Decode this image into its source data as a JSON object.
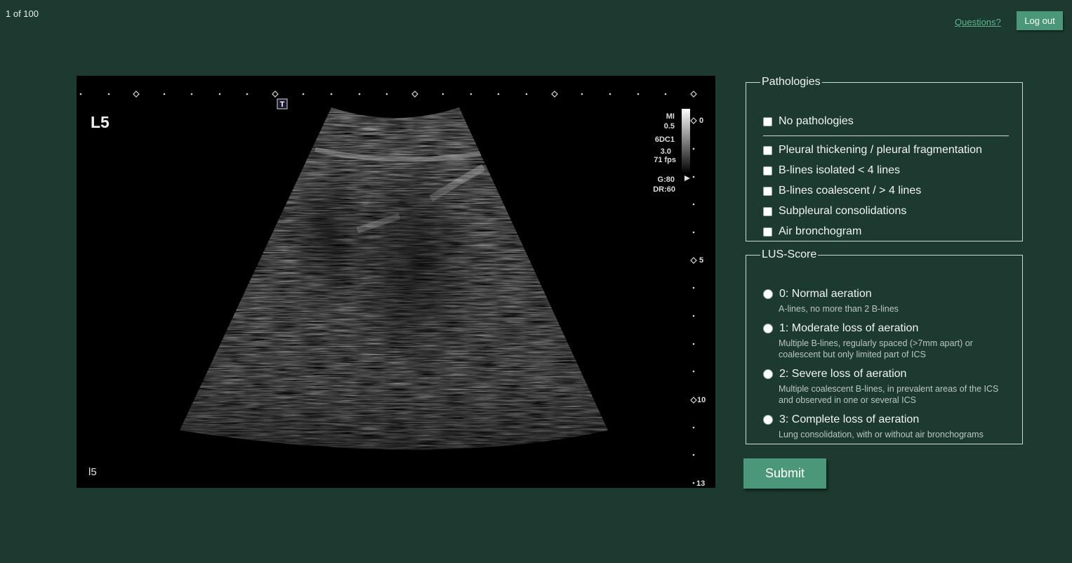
{
  "header": {
    "counter": "1 of 100",
    "questions_link": "Questions?",
    "logout_label": "Log out"
  },
  "ultrasound": {
    "zone_label": "L5",
    "zone_label_small": "l5",
    "marker": "T",
    "params": {
      "mi_label": "MI",
      "mi_value": "0.5",
      "probe": "6DC1",
      "freq": "3.0",
      "fps": "71 fps",
      "gain": "G:80",
      "dr": "DR:60"
    },
    "depth_labels": [
      "0",
      "5",
      "10",
      "13"
    ]
  },
  "pathologies": {
    "legend": "Pathologies",
    "none_label": "No pathologies",
    "items": [
      {
        "label": "Pleural thickening / pleural fragmentation"
      },
      {
        "label": "B-lines isolated < 4 lines"
      },
      {
        "label": "B-lines coalescent / > 4 lines"
      },
      {
        "label": "Subpleural consolidations"
      },
      {
        "label": "Air bronchogram"
      }
    ]
  },
  "lus_score": {
    "legend": "LUS-Score",
    "options": [
      {
        "label": "0: Normal aeration",
        "desc": "A-lines, no more than 2 B-lines"
      },
      {
        "label": "1: Moderate loss of aeration",
        "desc": "Multiple B-lines, regularly spaced (>7mm apart) or coalescent but only limited part of ICS"
      },
      {
        "label": "2: Severe loss of aeration",
        "desc": "Multiple coalescent B-lines, in prevalent areas of the ICS and observed in one or several ICS"
      },
      {
        "label": "3: Complete loss of aeration",
        "desc": "Lung consolidation, with or without air bronchograms"
      }
    ]
  },
  "submit_label": "Submit",
  "colors": {
    "background": "#1c3a30",
    "accent": "#4a977a",
    "link": "#5fb48f"
  }
}
